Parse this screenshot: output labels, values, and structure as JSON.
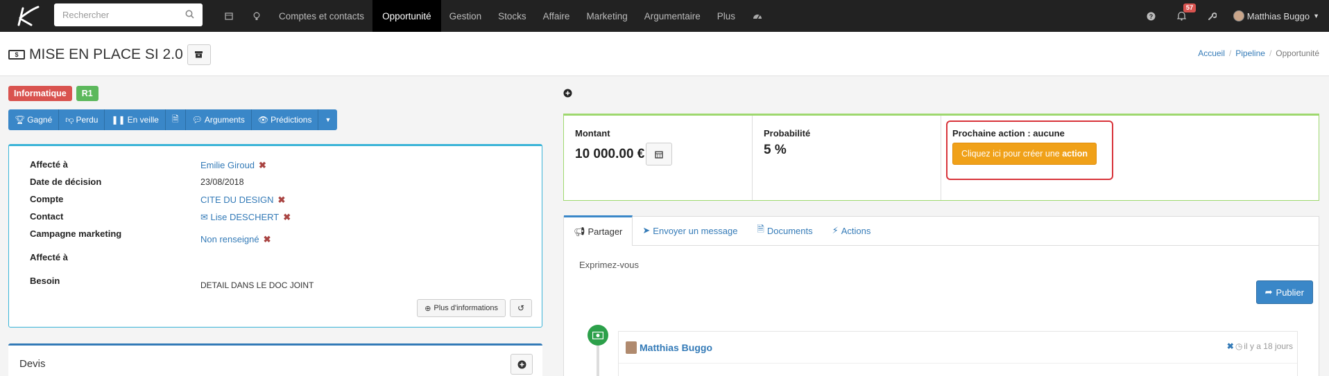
{
  "topbar": {
    "search_placeholder": "Rechercher",
    "menu": [
      {
        "label": "Comptes et contacts"
      },
      {
        "label": "Opportunité"
      },
      {
        "label": "Gestion"
      },
      {
        "label": "Stocks"
      },
      {
        "label": "Affaire"
      },
      {
        "label": "Marketing"
      },
      {
        "label": "Argumentaire"
      },
      {
        "label": "Plus"
      }
    ],
    "notification_count": "57",
    "user_name": "Matthias Buggo"
  },
  "page": {
    "title": "MISE EN PLACE SI 2.0",
    "breadcrumbs": [
      "Accueil",
      "Pipeline",
      "Opportunité"
    ]
  },
  "tags": [
    "Informatique",
    "R1"
  ],
  "actions": {
    "won": "Gagné",
    "lost": "Perdu",
    "standby": "En veille",
    "arguments": "Arguments",
    "predictions": "Prédictions"
  },
  "info": {
    "assigned_label": "Affecté à",
    "assigned_value": "Emilie Giroud",
    "decision_label": "Date de décision",
    "decision_value": "23/08/2018",
    "account_label": "Compte",
    "account_value": "CITE DU DESIGN",
    "contact_label": "Contact",
    "contact_value": "Lise DESCHERT",
    "campaign_label": "Campagne marketing",
    "campaign_value": "Non renseigné",
    "assigned2_label": "Affecté à",
    "need_label": "Besoin",
    "need_value": "DETAIL DANS LE DOC JOINT",
    "more_label": "Plus d'informations"
  },
  "devis": {
    "title": "Devis"
  },
  "stats": {
    "amount_label": "Montant",
    "amount_value": "10 000.00 €",
    "probability_label": "Probabilité",
    "probability_value": "5 %",
    "next_action_label": "Prochaine action : aucune",
    "create_action_prefix": "Cliquez ici pour créer une ",
    "create_action_bold": "action"
  },
  "social": {
    "tabs": [
      "Partager",
      "Envoyer un message",
      "Documents",
      "Actions"
    ],
    "placeholder": "Exprimez-vous",
    "publish_label": "Publier",
    "post_author": "Matthias Buggo",
    "post_time": "il y a 18 jours"
  },
  "colors": {
    "topbar": "#222222",
    "primary": "#3a87c8",
    "danger": "#d9534f",
    "success": "#5cb85c",
    "warning": "#f0a119"
  }
}
